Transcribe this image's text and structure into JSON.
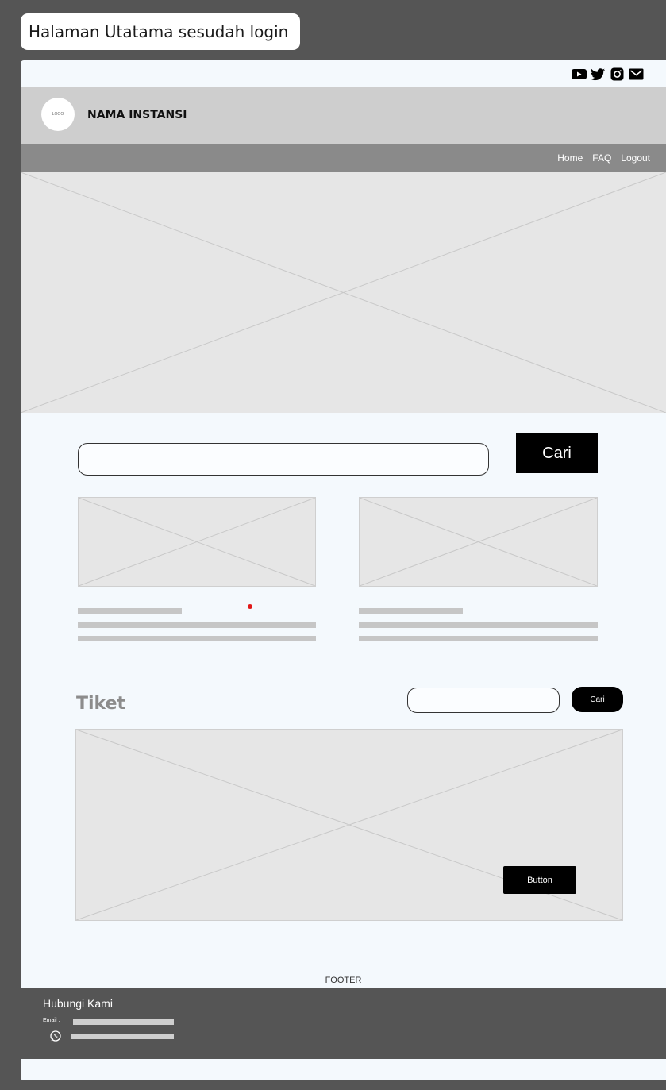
{
  "frame_title": "Halaman Utatama sesudah login",
  "social_icons": [
    "youtube-icon",
    "twitter-icon",
    "instagram-icon",
    "mail-icon"
  ],
  "header": {
    "logo_text": "LOGO",
    "brand": "NAMA INSTANSI"
  },
  "nav": {
    "items": [
      "Home",
      "FAQ",
      "Logout"
    ]
  },
  "search": {
    "button": "Cari",
    "value": "",
    "placeholder": ""
  },
  "tiket": {
    "title": "Tiket",
    "search_button": "Cari",
    "search_value": "",
    "action_button": "Button"
  },
  "footer": {
    "label": "FOOTER",
    "title": "Hubungi Kami",
    "email_label": "Email :"
  },
  "colors": {
    "background": "#555555",
    "page": "#f4f9fd",
    "header": "#cecece",
    "navbar": "#8a8a8a",
    "placeholder": "#e6e6e6",
    "button": "#000000",
    "marker": "#e11919"
  }
}
